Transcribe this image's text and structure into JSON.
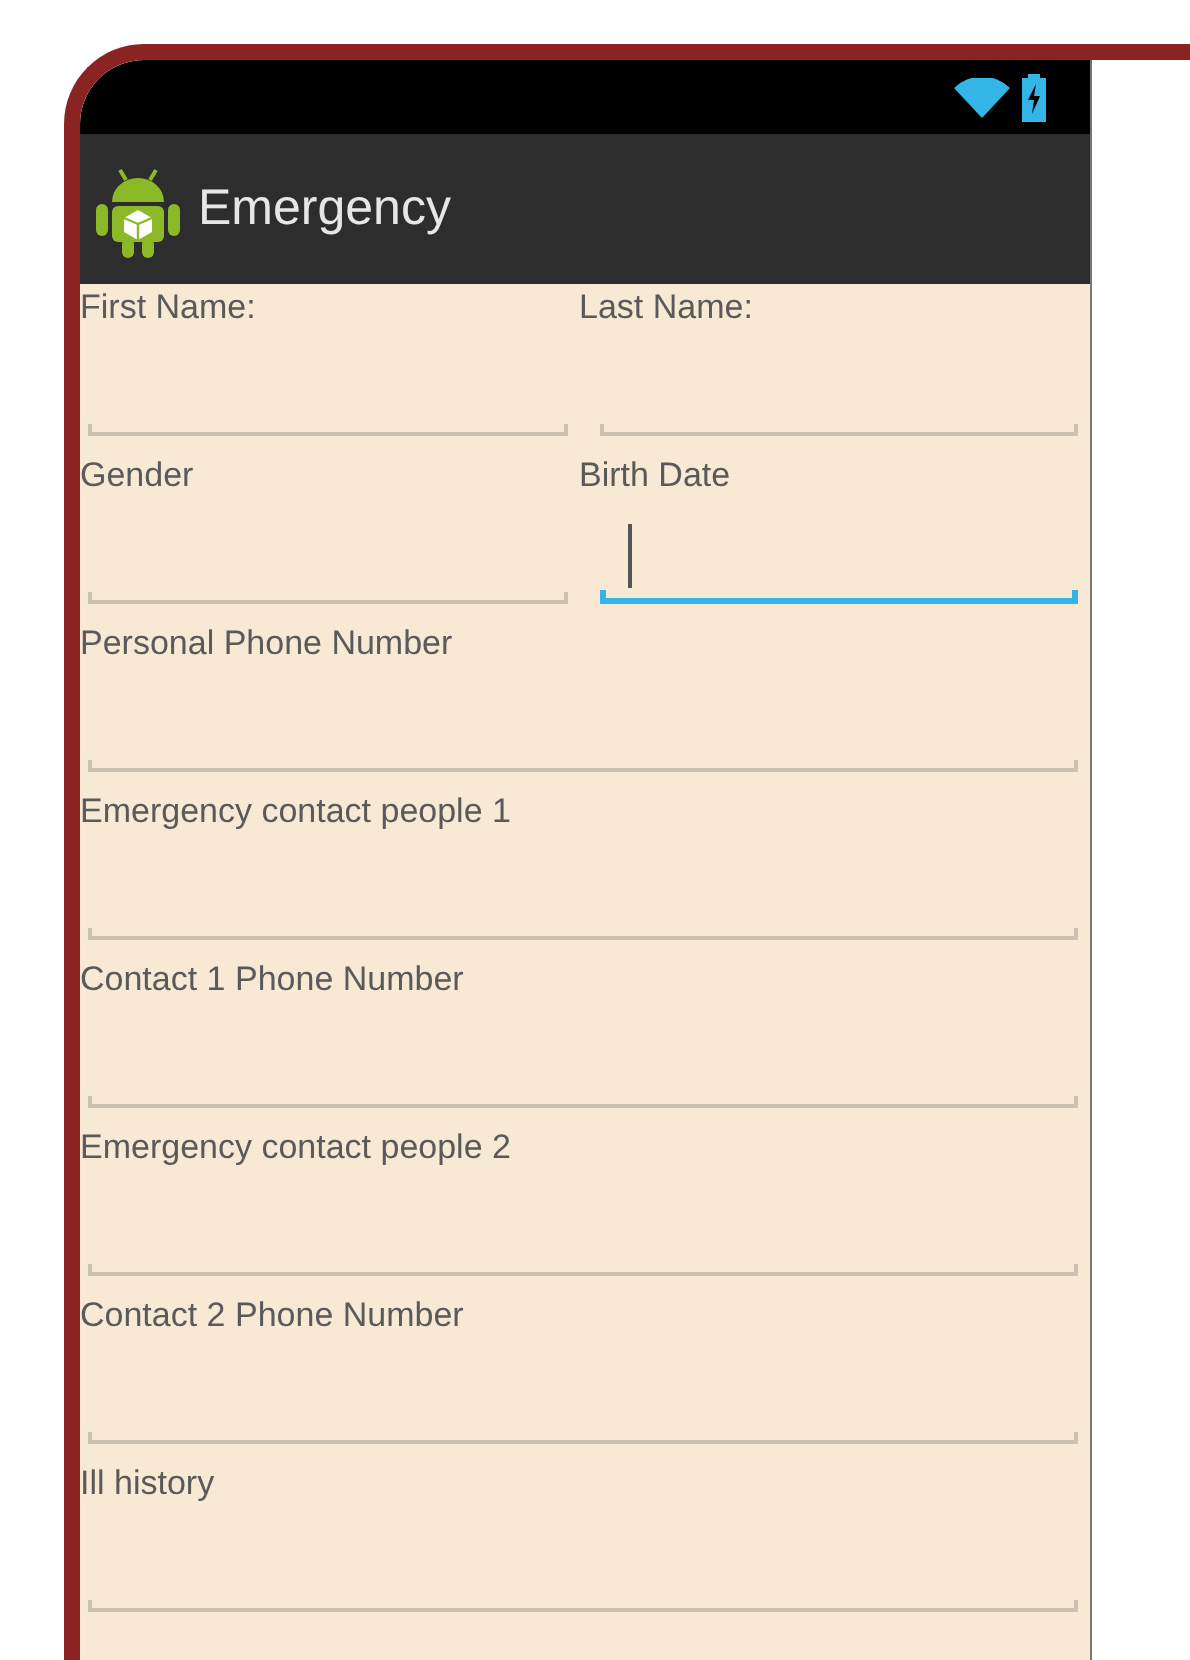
{
  "action_bar": {
    "title": "Emergency"
  },
  "rows": [
    {
      "fields": [
        {
          "label": "First Name:",
          "focused": false
        },
        {
          "label": "Last Name:",
          "focused": false
        }
      ]
    },
    {
      "fields": [
        {
          "label": "Gender",
          "focused": false
        },
        {
          "label": "Birth Date",
          "focused": true
        }
      ]
    },
    {
      "fields": [
        {
          "label": "Personal Phone Number",
          "focused": false
        }
      ]
    },
    {
      "fields": [
        {
          "label": "Emergency contact people 1",
          "focused": false
        }
      ]
    },
    {
      "fields": [
        {
          "label": "Contact 1 Phone Number",
          "focused": false
        }
      ]
    },
    {
      "fields": [
        {
          "label": "Emergency contact people 2",
          "focused": false
        }
      ]
    },
    {
      "fields": [
        {
          "label": "Contact 2 Phone Number",
          "focused": false
        }
      ]
    },
    {
      "fields": [
        {
          "label": "Ill history",
          "focused": false
        }
      ]
    }
  ]
}
